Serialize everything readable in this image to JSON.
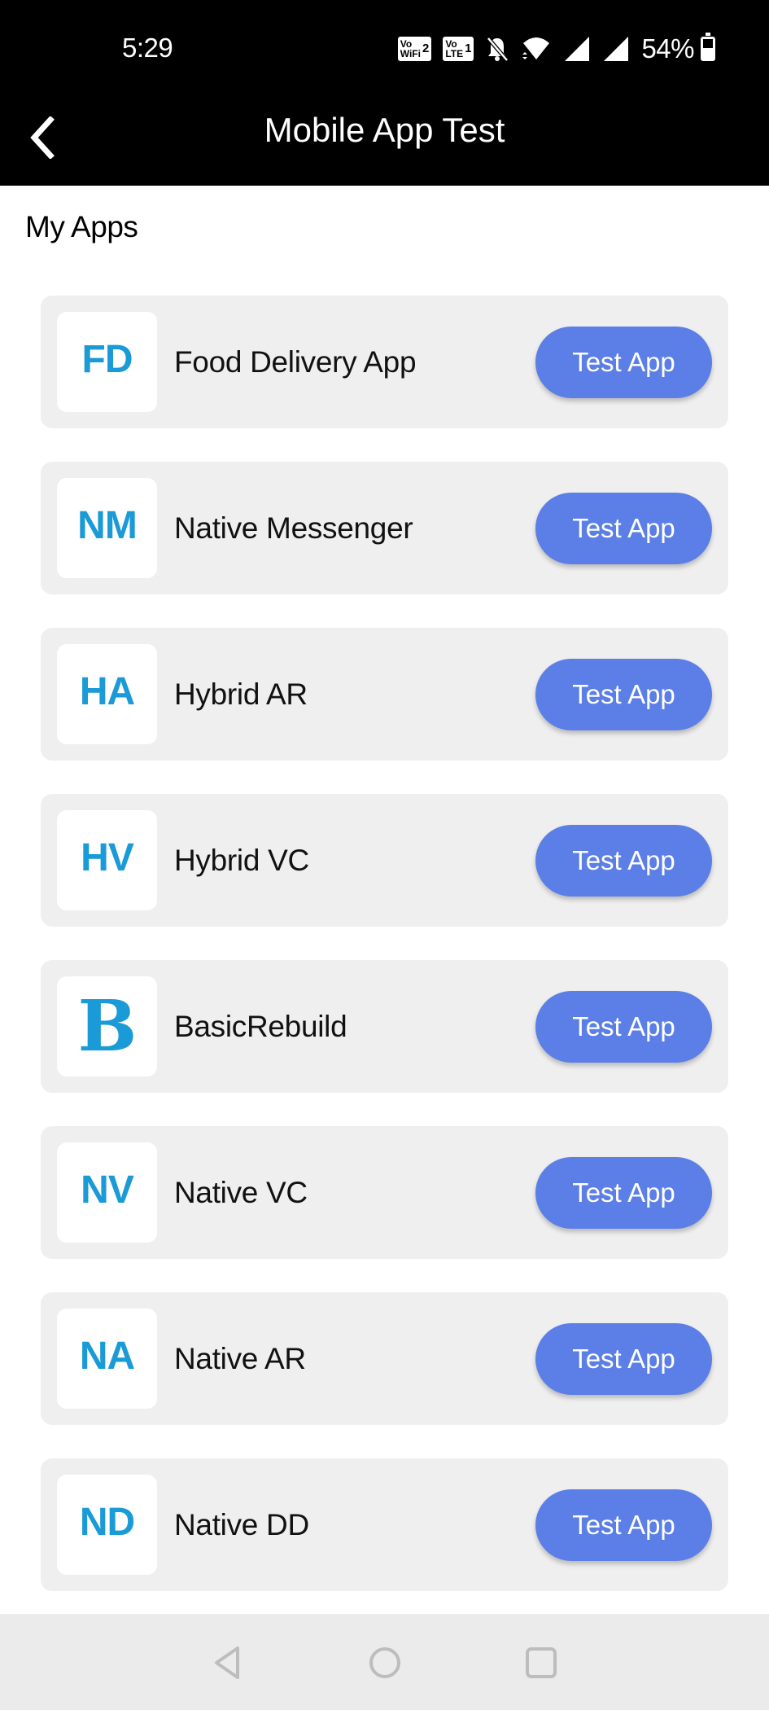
{
  "status_bar": {
    "time": "5:29",
    "vowifi_badge": {
      "top": "Vo",
      "bottom": "WiFi",
      "sim": "2"
    },
    "volte_badge": {
      "top": "Vo",
      "bottom": "LTE",
      "sim": "1"
    },
    "icons": [
      "vowifi-icon",
      "volte-icon",
      "bell-off-icon",
      "wifi-icon",
      "signal-icon",
      "signal-icon",
      "battery-icon"
    ],
    "battery_percent": "54%",
    "battery_level": 0.54
  },
  "app_bar": {
    "back_icon": "chevron-left-icon",
    "title": "Mobile App Test"
  },
  "section": {
    "title": "My Apps"
  },
  "apps": [
    {
      "icon_text": "FD",
      "name": "Food Delivery App",
      "button_label": "Test App"
    },
    {
      "icon_text": "NM",
      "name": "Native Messenger",
      "button_label": "Test App"
    },
    {
      "icon_text": "HA",
      "name": "Hybrid AR",
      "button_label": "Test App"
    },
    {
      "icon_text": "HV",
      "name": "Hybrid VC",
      "button_label": "Test App"
    },
    {
      "icon_text": "B",
      "name": "BasicRebuild",
      "button_label": "Test App"
    },
    {
      "icon_text": "NV",
      "name": "Native VC",
      "button_label": "Test App"
    },
    {
      "icon_text": "NA",
      "name": "Native AR",
      "button_label": "Test App"
    },
    {
      "icon_text": "ND",
      "name": "Native DD",
      "button_label": "Test App"
    }
  ],
  "nav_bar": {
    "buttons": [
      "back-triangle-icon",
      "home-circle-icon",
      "recents-square-icon"
    ]
  },
  "colors": {
    "accent_button": "#5b7fe6",
    "icon_text": "#1a9ad6",
    "card_background": "#efefef",
    "header_background": "#000000"
  }
}
